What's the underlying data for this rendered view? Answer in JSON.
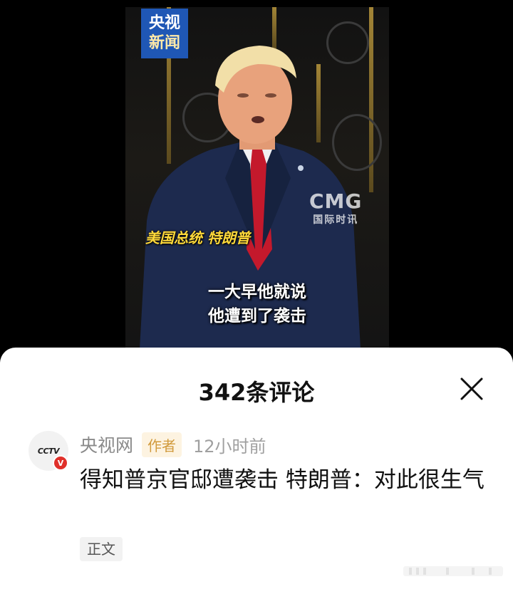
{
  "video": {
    "logo_line1": "央视",
    "logo_line2": "新闻",
    "watermark_big": "CMG",
    "watermark_small": "国际时讯",
    "caption": "美国总统 特朗普",
    "subtitle_line1": "一大早他就说",
    "subtitle_line2": "他遭到了袭击"
  },
  "comments": {
    "title": "342条评论",
    "close_icon": "close-icon",
    "items": [
      {
        "avatar_text": "CCTV",
        "verified_badge": "V",
        "author": "央视网",
        "author_tag": "作者",
        "time": "12小时前",
        "text": "得知普京官邸遭袭击 特朗普：对此很生气",
        "tag": "正文"
      }
    ]
  },
  "colors": {
    "accent_red": "#e0302a",
    "author_tag": "#d19a3c",
    "cctv_blue": "#1f57b5",
    "caption_yellow": "#ffd93a"
  }
}
